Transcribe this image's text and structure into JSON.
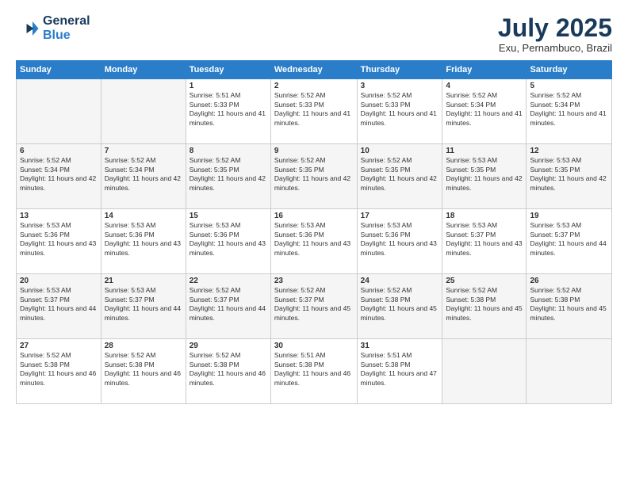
{
  "logo": {
    "line1": "General",
    "line2": "Blue"
  },
  "title": "July 2025",
  "subtitle": "Exu, Pernambuco, Brazil",
  "weekdays": [
    "Sunday",
    "Monday",
    "Tuesday",
    "Wednesday",
    "Thursday",
    "Friday",
    "Saturday"
  ],
  "weeks": [
    [
      {
        "day": "",
        "info": ""
      },
      {
        "day": "",
        "info": ""
      },
      {
        "day": "1",
        "info": "Sunrise: 5:51 AM\nSunset: 5:33 PM\nDaylight: 11 hours and 41 minutes."
      },
      {
        "day": "2",
        "info": "Sunrise: 5:52 AM\nSunset: 5:33 PM\nDaylight: 11 hours and 41 minutes."
      },
      {
        "day": "3",
        "info": "Sunrise: 5:52 AM\nSunset: 5:33 PM\nDaylight: 11 hours and 41 minutes."
      },
      {
        "day": "4",
        "info": "Sunrise: 5:52 AM\nSunset: 5:34 PM\nDaylight: 11 hours and 41 minutes."
      },
      {
        "day": "5",
        "info": "Sunrise: 5:52 AM\nSunset: 5:34 PM\nDaylight: 11 hours and 41 minutes."
      }
    ],
    [
      {
        "day": "6",
        "info": "Sunrise: 5:52 AM\nSunset: 5:34 PM\nDaylight: 11 hours and 42 minutes."
      },
      {
        "day": "7",
        "info": "Sunrise: 5:52 AM\nSunset: 5:34 PM\nDaylight: 11 hours and 42 minutes."
      },
      {
        "day": "8",
        "info": "Sunrise: 5:52 AM\nSunset: 5:35 PM\nDaylight: 11 hours and 42 minutes."
      },
      {
        "day": "9",
        "info": "Sunrise: 5:52 AM\nSunset: 5:35 PM\nDaylight: 11 hours and 42 minutes."
      },
      {
        "day": "10",
        "info": "Sunrise: 5:52 AM\nSunset: 5:35 PM\nDaylight: 11 hours and 42 minutes."
      },
      {
        "day": "11",
        "info": "Sunrise: 5:53 AM\nSunset: 5:35 PM\nDaylight: 11 hours and 42 minutes."
      },
      {
        "day": "12",
        "info": "Sunrise: 5:53 AM\nSunset: 5:35 PM\nDaylight: 11 hours and 42 minutes."
      }
    ],
    [
      {
        "day": "13",
        "info": "Sunrise: 5:53 AM\nSunset: 5:36 PM\nDaylight: 11 hours and 43 minutes."
      },
      {
        "day": "14",
        "info": "Sunrise: 5:53 AM\nSunset: 5:36 PM\nDaylight: 11 hours and 43 minutes."
      },
      {
        "day": "15",
        "info": "Sunrise: 5:53 AM\nSunset: 5:36 PM\nDaylight: 11 hours and 43 minutes."
      },
      {
        "day": "16",
        "info": "Sunrise: 5:53 AM\nSunset: 5:36 PM\nDaylight: 11 hours and 43 minutes."
      },
      {
        "day": "17",
        "info": "Sunrise: 5:53 AM\nSunset: 5:36 PM\nDaylight: 11 hours and 43 minutes."
      },
      {
        "day": "18",
        "info": "Sunrise: 5:53 AM\nSunset: 5:37 PM\nDaylight: 11 hours and 43 minutes."
      },
      {
        "day": "19",
        "info": "Sunrise: 5:53 AM\nSunset: 5:37 PM\nDaylight: 11 hours and 44 minutes."
      }
    ],
    [
      {
        "day": "20",
        "info": "Sunrise: 5:53 AM\nSunset: 5:37 PM\nDaylight: 11 hours and 44 minutes."
      },
      {
        "day": "21",
        "info": "Sunrise: 5:53 AM\nSunset: 5:37 PM\nDaylight: 11 hours and 44 minutes."
      },
      {
        "day": "22",
        "info": "Sunrise: 5:52 AM\nSunset: 5:37 PM\nDaylight: 11 hours and 44 minutes."
      },
      {
        "day": "23",
        "info": "Sunrise: 5:52 AM\nSunset: 5:37 PM\nDaylight: 11 hours and 45 minutes."
      },
      {
        "day": "24",
        "info": "Sunrise: 5:52 AM\nSunset: 5:38 PM\nDaylight: 11 hours and 45 minutes."
      },
      {
        "day": "25",
        "info": "Sunrise: 5:52 AM\nSunset: 5:38 PM\nDaylight: 11 hours and 45 minutes."
      },
      {
        "day": "26",
        "info": "Sunrise: 5:52 AM\nSunset: 5:38 PM\nDaylight: 11 hours and 45 minutes."
      }
    ],
    [
      {
        "day": "27",
        "info": "Sunrise: 5:52 AM\nSunset: 5:38 PM\nDaylight: 11 hours and 46 minutes."
      },
      {
        "day": "28",
        "info": "Sunrise: 5:52 AM\nSunset: 5:38 PM\nDaylight: 11 hours and 46 minutes."
      },
      {
        "day": "29",
        "info": "Sunrise: 5:52 AM\nSunset: 5:38 PM\nDaylight: 11 hours and 46 minutes."
      },
      {
        "day": "30",
        "info": "Sunrise: 5:51 AM\nSunset: 5:38 PM\nDaylight: 11 hours and 46 minutes."
      },
      {
        "day": "31",
        "info": "Sunrise: 5:51 AM\nSunset: 5:38 PM\nDaylight: 11 hours and 47 minutes."
      },
      {
        "day": "",
        "info": ""
      },
      {
        "day": "",
        "info": ""
      }
    ]
  ]
}
